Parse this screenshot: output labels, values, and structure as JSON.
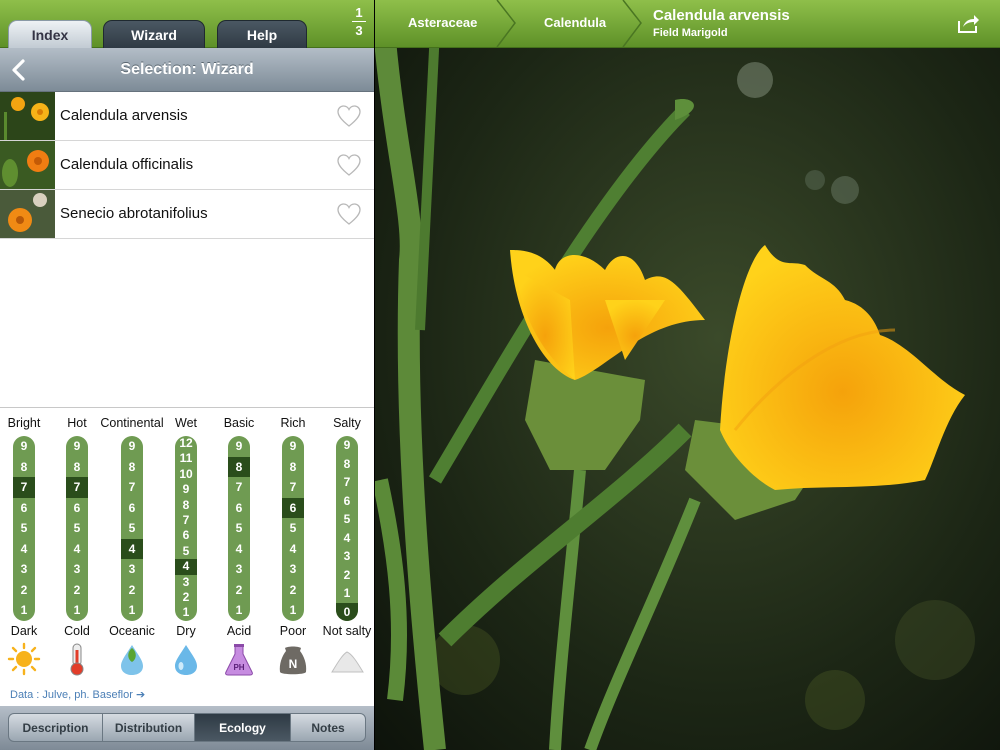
{
  "tabs": [
    {
      "label": "Index",
      "active": true
    },
    {
      "label": "Wizard",
      "active": false
    },
    {
      "label": "Help",
      "active": false
    }
  ],
  "pager": {
    "current": "1",
    "total": "3"
  },
  "nav": {
    "title": "Selection: Wizard",
    "back_icon": "chevron-left-icon"
  },
  "list": [
    {
      "name": "Calendula arvensis",
      "icon": "heart-icon"
    },
    {
      "name": "Calendula officinalis",
      "icon": "heart-icon"
    },
    {
      "name": "Senecio abrotanifolius",
      "icon": "heart-icon"
    }
  ],
  "ecology": [
    {
      "top": "Bright",
      "bottom": "Dark",
      "values": [
        "9",
        "8",
        "7",
        "6",
        "5",
        "4",
        "3",
        "2",
        "1"
      ],
      "selected": "7",
      "icon": "sun-icon"
    },
    {
      "top": "Hot",
      "bottom": "Cold",
      "values": [
        "9",
        "8",
        "7",
        "6",
        "5",
        "4",
        "3",
        "2",
        "1"
      ],
      "selected": "7",
      "icon": "thermometer-icon"
    },
    {
      "top": "Continental",
      "bottom": "Oceanic",
      "values": [
        "9",
        "8",
        "7",
        "6",
        "5",
        "4",
        "3",
        "2",
        "1"
      ],
      "selected": "4",
      "icon": "drop-leaf-icon"
    },
    {
      "top": "Wet",
      "bottom": "Dry",
      "values": [
        "12",
        "11",
        "10",
        "9",
        "8",
        "7",
        "6",
        "5",
        "4",
        "3",
        "2",
        "1"
      ],
      "selected": "4",
      "icon": "water-drop-icon"
    },
    {
      "top": "Basic",
      "bottom": "Acid",
      "values": [
        "9",
        "8",
        "7",
        "6",
        "5",
        "4",
        "3",
        "2",
        "1"
      ],
      "selected": "8",
      "icon": "flask-icon",
      "icon_text": "PH"
    },
    {
      "top": "Rich",
      "bottom": "Poor",
      "values": [
        "9",
        "8",
        "7",
        "6",
        "5",
        "4",
        "3",
        "2",
        "1"
      ],
      "selected": "6",
      "icon": "nitrogen-bag-icon",
      "icon_text": "N"
    },
    {
      "top": "Salty",
      "bottom": "Not salty",
      "values": [
        "9",
        "8",
        "7",
        "6",
        "5",
        "4",
        "3",
        "2",
        "1",
        "0"
      ],
      "selected": "0",
      "icon": "salt-pile-icon"
    }
  ],
  "source": {
    "text": "Data : Julve, ph. Baseflor",
    "arrow": "➔"
  },
  "bottom_tabs": [
    {
      "label": "Description",
      "active": false
    },
    {
      "label": "Distribution",
      "active": false
    },
    {
      "label": "Ecology",
      "active": true
    },
    {
      "label": "Notes",
      "active": false
    }
  ],
  "breadcrumb": {
    "family": "Asteraceae",
    "genus": "Calendula",
    "species": "Calendula arvensis",
    "common_name": "Field Marigold",
    "share_icon": "share-icon"
  },
  "colors": {
    "accent_green": "#6ea238",
    "bar_green": "#6f9b52",
    "bar_selected": "#2a4d1b",
    "link_blue": "#4b7fb6"
  }
}
